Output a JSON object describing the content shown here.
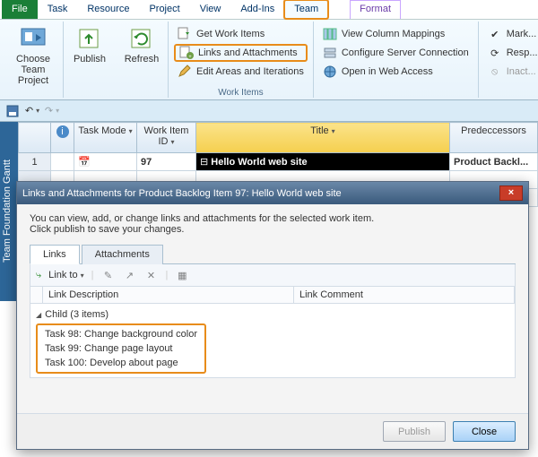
{
  "tabs": {
    "file": "File",
    "task": "Task",
    "resource": "Resource",
    "project": "Project",
    "view": "View",
    "addins": "Add-Ins",
    "team": "Team",
    "format": "Format"
  },
  "ribbon": {
    "choose": "Choose Team Project",
    "publish": "Publish",
    "refresh": "Refresh",
    "getwork": "Get Work Items",
    "links": "Links and Attachments",
    "editareas": "Edit Areas and Iterations",
    "viewcol": "View Column Mappings",
    "config": "Configure Server Connection",
    "openweb": "Open in Web Access",
    "mark": "Mark...",
    "resp": "Resp...",
    "inact": "Inact...",
    "group_workitems": "Work Items"
  },
  "sidetab": "Team Foundation Gantt",
  "grid": {
    "h_info": "",
    "h_mode": "Task Mode",
    "h_id": "Work Item ID",
    "h_title": "Title",
    "h_pred": "Predeccessors",
    "row1_num": "1",
    "row1_id": "97",
    "row1_title": "Hello World web site",
    "row1_pred": "Product Backl...",
    "title_prefix": "⊟"
  },
  "dialog": {
    "title": "Links and Attachments for Product Backlog Item 97: Hello World web site",
    "intro1": "You can view, add, or change links and attachments for the selected work item.",
    "intro2": "Click publish to save your changes.",
    "tab_links": "Links",
    "tab_att": "Attachments",
    "linkto": "Link to",
    "col_desc": "Link Description",
    "col_comment": "Link Comment",
    "group": "Child (3 items)",
    "items": [
      "Task 98: Change background color",
      "Task 99: Change page layout",
      "Task 100: Develop about page"
    ],
    "publish": "Publish",
    "close": "Close"
  }
}
